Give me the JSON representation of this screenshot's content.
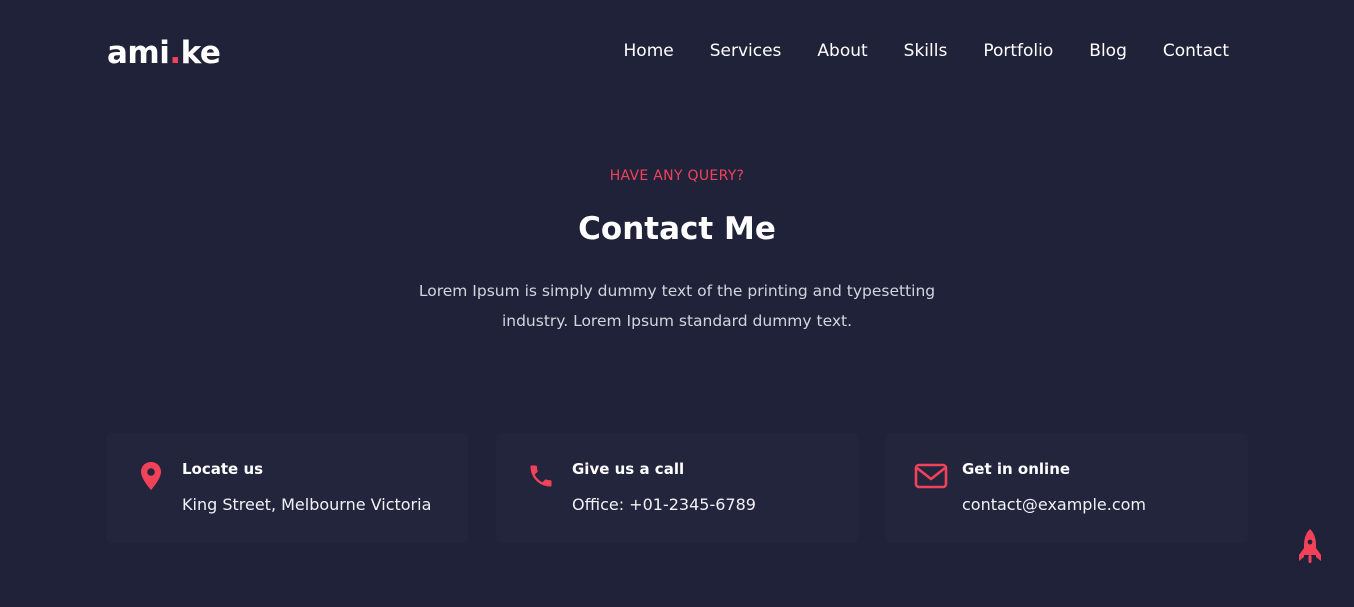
{
  "brand": {
    "logo_left": "ami",
    "logo_dot": ".",
    "logo_right": "ke"
  },
  "nav": {
    "items": [
      {
        "label": "Home"
      },
      {
        "label": "Services"
      },
      {
        "label": "About"
      },
      {
        "label": "Skills"
      },
      {
        "label": "Portfolio"
      },
      {
        "label": "Blog"
      },
      {
        "label": "Contact"
      }
    ]
  },
  "contact_section": {
    "eyebrow": "HAVE ANY QUERY?",
    "title": "Contact Me",
    "description": "Lorem Ipsum is simply dummy text of the printing and typesetting industry. Lorem Ipsum standard dummy text."
  },
  "cards": [
    {
      "icon": "map-pin-icon",
      "heading": "Locate us",
      "value": "King Street, Melbourne Victoria"
    },
    {
      "icon": "phone-icon",
      "heading": "Give us a call",
      "value": "Office: +01-2345-6789"
    },
    {
      "icon": "envelope-icon",
      "heading": "Get in online",
      "value": "contact@example.com"
    }
  ],
  "colors": {
    "background": "#202239",
    "card": "#23253d",
    "accent": "#f2425a",
    "text": "#ffffff"
  },
  "back_to_top": {
    "icon": "rocket-icon"
  }
}
